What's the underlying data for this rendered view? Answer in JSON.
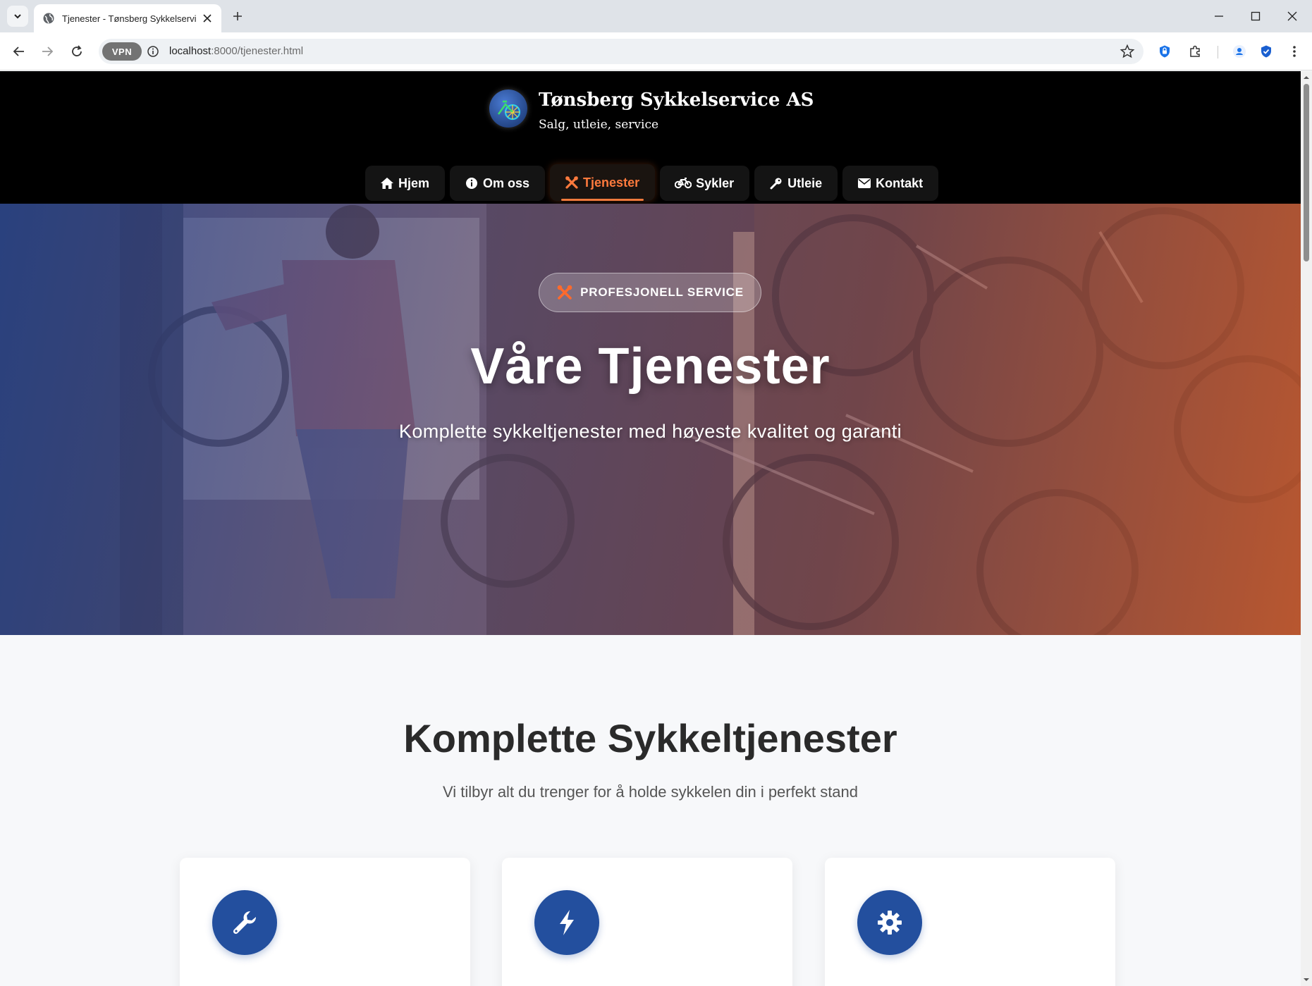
{
  "browser": {
    "tab_title": "Tjenester - Tønsberg Sykkelservice AS",
    "url_host": "localhost",
    "url_rest": ":8000/tjenester.html",
    "vpn_label": "VPN"
  },
  "site": {
    "name": "Tønsberg Sykkelservice AS",
    "tagline": "Salg, utleie, service"
  },
  "nav": {
    "items": [
      {
        "label": "Hjem",
        "icon": "home-icon"
      },
      {
        "label": "Om oss",
        "icon": "info-icon"
      },
      {
        "label": "Tjenester",
        "icon": "tools-icon",
        "active": true
      },
      {
        "label": "Sykler",
        "icon": "bicycle-icon"
      },
      {
        "label": "Utleie",
        "icon": "key-icon"
      },
      {
        "label": "Kontakt",
        "icon": "envelope-icon"
      }
    ]
  },
  "hero": {
    "badge": "PROFESJONELL SERVICE",
    "title": "Våre Tjenester",
    "subtitle": "Komplette sykkeltjenester med høyeste kvalitet og garanti"
  },
  "services": {
    "title": "Komplette Sykkeltjenester",
    "subtitle": "Vi tilbyr alt du trenger for å holde sykkelen din i perfekt stand",
    "cards": [
      {
        "icon": "wrench-icon"
      },
      {
        "icon": "bolt-icon"
      },
      {
        "icon": "gear-icon"
      }
    ]
  },
  "colors": {
    "accent": "#f07a3c",
    "brand_blue": "#234f9e",
    "header_bg": "#000000"
  }
}
